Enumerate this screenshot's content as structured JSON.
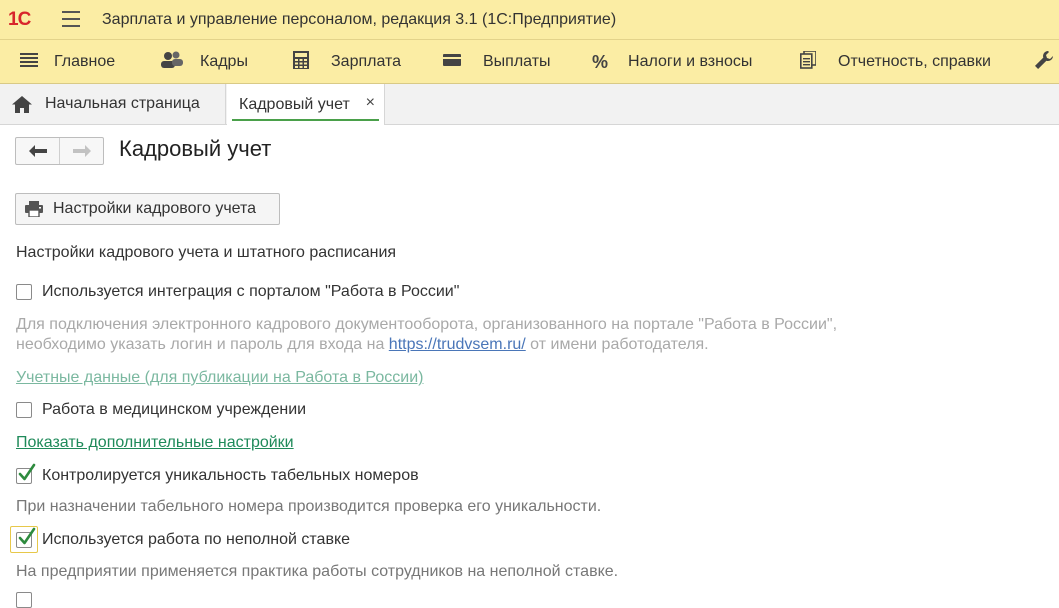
{
  "app": {
    "logo": "1С",
    "title": "Зарплата и управление персоналом, редакция 3.1  (1С:Предприятие)"
  },
  "sections": [
    {
      "label": "Главное",
      "icon": "menu-lines-icon"
    },
    {
      "label": "Кадры",
      "icon": "people-icon"
    },
    {
      "label": "Зарплата",
      "icon": "calculator-icon"
    },
    {
      "label": "Выплаты",
      "icon": "wallet-icon"
    },
    {
      "label": "Налоги и взносы",
      "icon": "percent-icon"
    },
    {
      "label": "Отчетность, справки",
      "icon": "documents-icon"
    },
    {
      "label": "",
      "icon": "wrench-icon"
    }
  ],
  "tabs": {
    "home": "Начальная страница",
    "active": "Кадровый учет",
    "close_symbol": "×"
  },
  "form": {
    "title": "Кадровый учет",
    "settings_button": "Настройки кадрового учета",
    "section_heading": "Настройки кадрового учета и штатного расписания",
    "portal_checkbox": {
      "label": "Используется интеграция с порталом \"Работа в России\"",
      "checked": false
    },
    "portal_hint_line1": "Для подключения электронного кадрового документооборота, организованного на портале \"Работа в России\",",
    "portal_hint_line2_before": "необходимо указать логин и пароль для входа на ",
    "portal_hint_link": "https://trudvsem.ru/",
    "portal_hint_line2_after": " от имени работодателя.",
    "credentials_link": "Учетные данные (для публикации на Работа в России)",
    "medical_checkbox": {
      "label": "Работа в медицинском учреждении",
      "checked": false
    },
    "more_settings_link": "Показать дополнительные настройки",
    "unique_checkbox": {
      "label": "Контролируется уникальность табельных номеров",
      "checked": true
    },
    "unique_hint": "При назначении табельного номера производится проверка его уникальности.",
    "parttime_checkbox": {
      "label": "Используется работа по неполной ставке",
      "checked": true
    },
    "parttime_hint": "На предприятии применяется практика работы сотрудников на неполной ставке."
  },
  "colors": {
    "accent_yellow": "#fbeda4",
    "check_green": "#2e8b3e",
    "link_green": "#1f8a5a"
  }
}
